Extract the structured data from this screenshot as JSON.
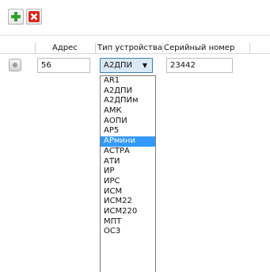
{
  "toolbar": {
    "add_icon": "plus-icon",
    "delete_icon": "red-x-icon",
    "add_color": "#2ea12e",
    "delete_color": "#d9261c"
  },
  "columns": [
    "Адрес",
    "Тип устройства",
    "Серийный номер"
  ],
  "row": {
    "address": "56",
    "device_type": "А2ДПИ",
    "serial": "23442"
  },
  "dropdown": {
    "options": [
      "AR1",
      "А2ДПИ",
      "А2ДПИм",
      "АМК",
      "АОПИ",
      "АР5",
      "АРмини",
      "АСТРА",
      "АТИ",
      "ИР",
      "ИРС",
      "ИСМ",
      "ИСМ22",
      "ИСМ220",
      "МПТ",
      "ОС3"
    ],
    "highlighted": "АРмини",
    "highlight_color": "#3399ff"
  }
}
